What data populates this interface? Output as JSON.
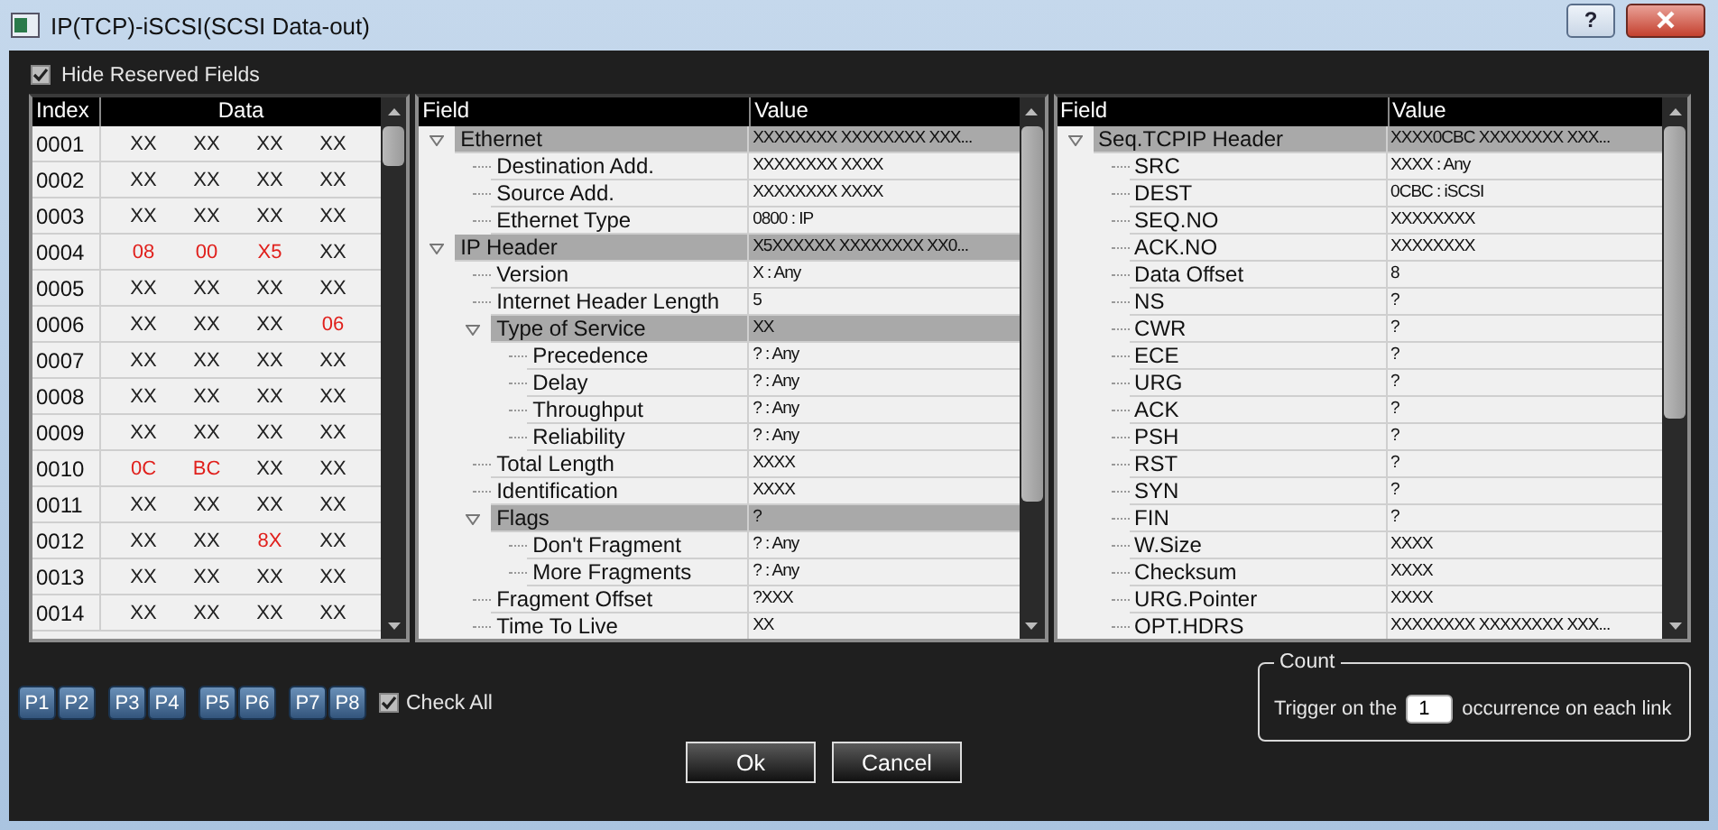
{
  "window": {
    "title": "IP(TCP)-iSCSI(SCSI Data-out)",
    "help_button": "?"
  },
  "hide_reserved_fields": {
    "label": "Hide Reserved Fields",
    "checked": true
  },
  "data_table": {
    "columns": [
      "Index",
      "Data"
    ],
    "rows": [
      {
        "index": "0001",
        "cells": [
          {
            "text": "XX",
            "highlighted": false
          },
          {
            "text": "XX",
            "highlighted": false
          },
          {
            "text": "XX",
            "highlighted": false
          },
          {
            "text": "XX",
            "highlighted": false
          }
        ]
      },
      {
        "index": "0002",
        "cells": [
          {
            "text": "XX",
            "highlighted": false
          },
          {
            "text": "XX",
            "highlighted": false
          },
          {
            "text": "XX",
            "highlighted": false
          },
          {
            "text": "XX",
            "highlighted": false
          }
        ]
      },
      {
        "index": "0003",
        "cells": [
          {
            "text": "XX",
            "highlighted": false
          },
          {
            "text": "XX",
            "highlighted": false
          },
          {
            "text": "XX",
            "highlighted": false
          },
          {
            "text": "XX",
            "highlighted": false
          }
        ]
      },
      {
        "index": "0004",
        "cells": [
          {
            "text": "08",
            "highlighted": true
          },
          {
            "text": "00",
            "highlighted": true
          },
          {
            "text": "X5",
            "highlighted": true
          },
          {
            "text": "XX",
            "highlighted": false
          }
        ]
      },
      {
        "index": "0005",
        "cells": [
          {
            "text": "XX",
            "highlighted": false
          },
          {
            "text": "XX",
            "highlighted": false
          },
          {
            "text": "XX",
            "highlighted": false
          },
          {
            "text": "XX",
            "highlighted": false
          }
        ]
      },
      {
        "index": "0006",
        "cells": [
          {
            "text": "XX",
            "highlighted": false
          },
          {
            "text": "XX",
            "highlighted": false
          },
          {
            "text": "XX",
            "highlighted": false
          },
          {
            "text": "06",
            "highlighted": true
          }
        ]
      },
      {
        "index": "0007",
        "cells": [
          {
            "text": "XX",
            "highlighted": false
          },
          {
            "text": "XX",
            "highlighted": false
          },
          {
            "text": "XX",
            "highlighted": false
          },
          {
            "text": "XX",
            "highlighted": false
          }
        ]
      },
      {
        "index": "0008",
        "cells": [
          {
            "text": "XX",
            "highlighted": false
          },
          {
            "text": "XX",
            "highlighted": false
          },
          {
            "text": "XX",
            "highlighted": false
          },
          {
            "text": "XX",
            "highlighted": false
          }
        ]
      },
      {
        "index": "0009",
        "cells": [
          {
            "text": "XX",
            "highlighted": false
          },
          {
            "text": "XX",
            "highlighted": false
          },
          {
            "text": "XX",
            "highlighted": false
          },
          {
            "text": "XX",
            "highlighted": false
          }
        ]
      },
      {
        "index": "0010",
        "cells": [
          {
            "text": "0C",
            "highlighted": true
          },
          {
            "text": "BC",
            "highlighted": true
          },
          {
            "text": "XX",
            "highlighted": false
          },
          {
            "text": "XX",
            "highlighted": false
          }
        ]
      },
      {
        "index": "0011",
        "cells": [
          {
            "text": "XX",
            "highlighted": false
          },
          {
            "text": "XX",
            "highlighted": false
          },
          {
            "text": "XX",
            "highlighted": false
          },
          {
            "text": "XX",
            "highlighted": false
          }
        ]
      },
      {
        "index": "0012",
        "cells": [
          {
            "text": "XX",
            "highlighted": false
          },
          {
            "text": "XX",
            "highlighted": false
          },
          {
            "text": "8X",
            "highlighted": true
          },
          {
            "text": "XX",
            "highlighted": false
          }
        ]
      },
      {
        "index": "0013",
        "cells": [
          {
            "text": "XX",
            "highlighted": false
          },
          {
            "text": "XX",
            "highlighted": false
          },
          {
            "text": "XX",
            "highlighted": false
          },
          {
            "text": "XX",
            "highlighted": false
          }
        ]
      },
      {
        "index": "0014",
        "cells": [
          {
            "text": "XX",
            "highlighted": false
          },
          {
            "text": "XX",
            "highlighted": false
          },
          {
            "text": "XX",
            "highlighted": false
          },
          {
            "text": "XX",
            "highlighted": false
          }
        ]
      }
    ]
  },
  "middle_tree": {
    "columns": [
      "Field",
      "Value"
    ],
    "rows": [
      {
        "field": "Ethernet",
        "value": "XXXXXXXX XXXXXXXX XXX...",
        "expanded": true,
        "children": [
          {
            "field": "Destination Add.",
            "value": "XXXXXXXX XXXX"
          },
          {
            "field": "Source Add.",
            "value": "XXXXXXXX XXXX"
          },
          {
            "field": "Ethernet Type",
            "value": "0800 : IP"
          }
        ]
      },
      {
        "field": "IP Header",
        "value": "X5XXXXXX XXXXXXXX XX0...",
        "expanded": true,
        "children": [
          {
            "field": "Version",
            "value": "X : Any"
          },
          {
            "field": "Internet Header Length",
            "value": "5"
          },
          {
            "field": "Type of Service",
            "value": "XX",
            "expanded": true,
            "children": [
              {
                "field": "Precedence",
                "value": "? : Any"
              },
              {
                "field": "Delay",
                "value": "? : Any"
              },
              {
                "field": "Throughput",
                "value": "? : Any"
              },
              {
                "field": "Reliability",
                "value": "? : Any"
              }
            ]
          },
          {
            "field": "Total Length",
            "value": "XXXX"
          },
          {
            "field": "Identification",
            "value": "XXXX"
          },
          {
            "field": "Flags",
            "value": "?",
            "expanded": true,
            "children": [
              {
                "field": "Don't Fragment",
                "value": "? : Any"
              },
              {
                "field": "More Fragments",
                "value": "? : Any"
              }
            ]
          },
          {
            "field": "Fragment Offset",
            "value": "?XXX"
          },
          {
            "field": "Time To Live",
            "value": "XX"
          }
        ]
      }
    ]
  },
  "right_tree": {
    "columns": [
      "Field",
      "Value"
    ],
    "rows": [
      {
        "field": "Seq.TCPIP Header",
        "value": "XXXX0CBC XXXXXXXX XXX...",
        "expanded": true,
        "children": [
          {
            "field": "SRC",
            "value": "XXXX : Any"
          },
          {
            "field": "DEST",
            "value": "0CBC : iSCSI"
          },
          {
            "field": "SEQ.NO",
            "value": "XXXXXXXX"
          },
          {
            "field": "ACK.NO",
            "value": "XXXXXXXX"
          },
          {
            "field": "Data Offset",
            "value": "8"
          },
          {
            "field": "NS",
            "value": "?"
          },
          {
            "field": "CWR",
            "value": "?"
          },
          {
            "field": "ECE",
            "value": "?"
          },
          {
            "field": "URG",
            "value": "?"
          },
          {
            "field": "ACK",
            "value": "?"
          },
          {
            "field": "PSH",
            "value": "?"
          },
          {
            "field": "RST",
            "value": "?"
          },
          {
            "field": "SYN",
            "value": "?"
          },
          {
            "field": "FIN",
            "value": "?"
          },
          {
            "field": "W.Size",
            "value": "XXXX"
          },
          {
            "field": "Checksum",
            "value": "XXXX"
          },
          {
            "field": "URG.Pointer",
            "value": "XXXX"
          },
          {
            "field": "OPT.HDRS",
            "value": "XXXXXXXX XXXXXXXX XXX..."
          }
        ]
      }
    ]
  },
  "port_buttons": [
    [
      "P1",
      "P2"
    ],
    [
      "P3",
      "P4"
    ],
    [
      "P5",
      "P6"
    ],
    [
      "P7",
      "P8"
    ]
  ],
  "check_all": {
    "label": "Check All",
    "checked": true
  },
  "count": {
    "legend": "Count",
    "prefix": "Trigger on the",
    "value": "1",
    "suffix": "occurrence on each link"
  },
  "buttons": [
    "Ok",
    "Cancel"
  ]
}
